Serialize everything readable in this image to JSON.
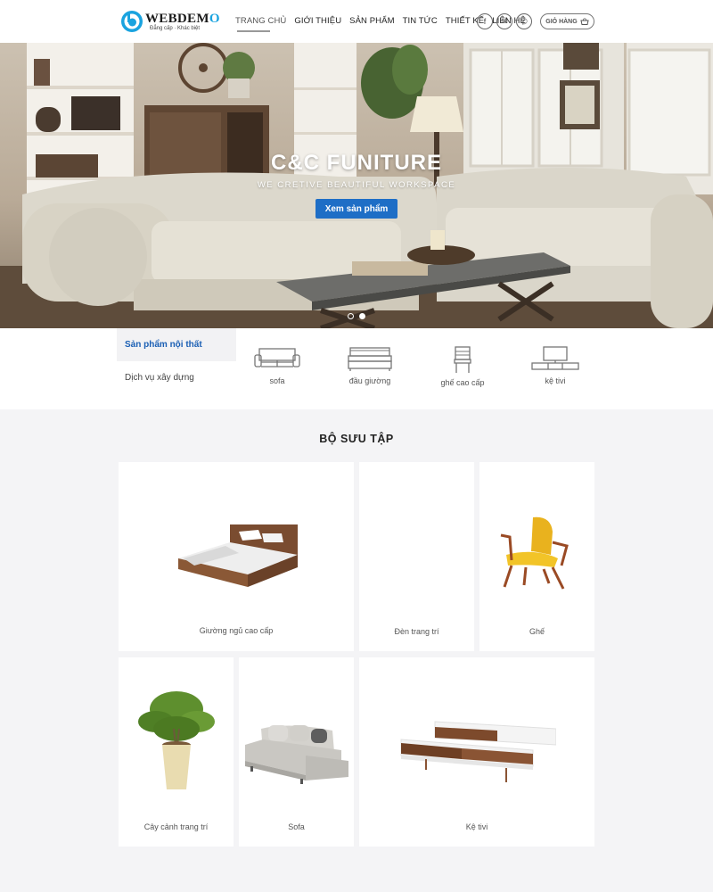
{
  "brand": {
    "name_main": "WEBDEM",
    "name_accent": "O",
    "tagline": "Đẳng cấp · Khác biệt"
  },
  "nav": {
    "items": [
      "TRANG CHỦ",
      "GIỚI THIỆU",
      "SẢN PHẨM",
      "TIN TỨC",
      "THIẾT KẾ",
      "LIÊN HỆ"
    ],
    "active_index": 0
  },
  "social": {
    "facebook_glyph": "f",
    "mail_glyph": "✉",
    "phone_glyph": "✆"
  },
  "cart": {
    "label": "GIỎ HÀNG",
    "icon": "basket-icon"
  },
  "hero": {
    "title": "C&C FUNITURE",
    "subtitle": "WE CRETIVE BEAUTIFUL WORKSPACE",
    "button": "Xem sản phẩm",
    "slides": 2,
    "active_slide": 2
  },
  "side_tabs": [
    "Sản phẩm nội thất",
    "Dịch vụ xây dựng"
  ],
  "categories": [
    {
      "label": "sofa",
      "icon": "sofa-icon"
    },
    {
      "label": "đầu giường",
      "icon": "bed-icon"
    },
    {
      "label": "ghế cao cấp",
      "icon": "chair-icon"
    },
    {
      "label": "kệ tivi",
      "icon": "tv-stand-icon"
    }
  ],
  "collection": {
    "title": "BỘ SƯU TẬP",
    "items": [
      "Giường ngủ cao cấp",
      "Đèn trang trí",
      "Ghế",
      "Cây cảnh trang trí",
      "Sofa",
      "Kệ tivi"
    ]
  },
  "colors": {
    "accent_blue": "#1e6ec6",
    "logo_blue": "#1aa3df",
    "active_tab_text": "#1a5fb4",
    "page_bg": "#f4f4f6"
  }
}
